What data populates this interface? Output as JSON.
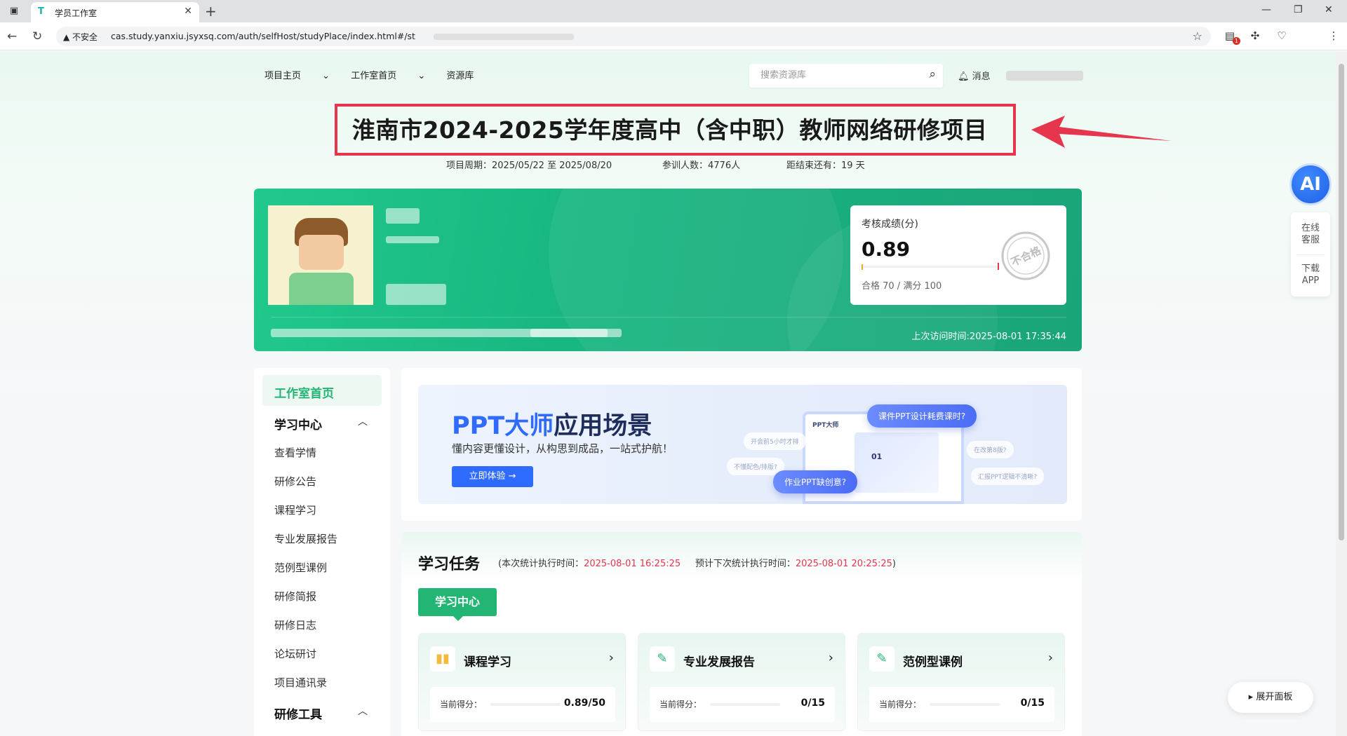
{
  "browser": {
    "tab_title": "学员工作室",
    "insecure_label": "不安全",
    "url": "cas.study.yanxiu.jsyxsq.com/auth/selfHost/studyPlace/index.html#/st",
    "ext_badge": "1"
  },
  "topnav": {
    "items": [
      "项目主页",
      "工作室首页",
      "资源库"
    ],
    "search_placeholder": "搜索资源库",
    "messages": "消息"
  },
  "project": {
    "title": "淮南市2024-2025学年度高中（含中职）教师网络研修项目",
    "period_label": "项目周期：",
    "period": "2025/05/22 至 2025/08/20",
    "participants_label": "参训人数：",
    "participants": "4776人",
    "remaining_label": "距结束还有：",
    "remaining": "19 天"
  },
  "score": {
    "label": "考核成绩(分)",
    "value": "0.89",
    "progress_fraction": 0.0127,
    "pass_label": "合格 70 / 满分 100",
    "stamp_text": "不合格",
    "last_visit": "上次访问时间:2025-08-01 17:35:44"
  },
  "sidebar": {
    "home": "工作室首页",
    "section1": "学习中心",
    "items": [
      "查看学情",
      "研修公告",
      "课程学习",
      "专业发展报告",
      "范例型课例",
      "研修简报",
      "研修日志",
      "论坛研讨",
      "项目通讯录"
    ],
    "section2": "研修工具"
  },
  "ad": {
    "title_a": "PPT大师",
    "title_b": "应用场景",
    "subtitle": "懂内容更懂设计，从构思到成品，一站式护航！",
    "button": "立即体验",
    "mock_title": "PPT大师",
    "mock_slide": "01",
    "pill1": "课件PPT设计耗费课时?",
    "pill2": "作业PPT缺创意?",
    "ghost1": "开会前5小时才排",
    "ghost2": "不懂配色/排版?",
    "ghost3": "在改第8版?",
    "ghost4": "汇报PPT逻辑不清晰?"
  },
  "tasks": {
    "title": "学习任务",
    "note_open": "(本次统计执行时间：",
    "run_time": "2025-08-01 16:25:25",
    "note_mid": "预计下次统计执行时间：",
    "next_time": "2025-08-01 20:25:25",
    "note_close": ")",
    "tab": "学习中心",
    "cards": [
      {
        "name": "课程学习",
        "score_label": "当前得分：",
        "score": "0.89/50"
      },
      {
        "name": "专业发展报告",
        "score_label": "当前得分：",
        "score": "0/15"
      },
      {
        "name": "范例型课例",
        "score_label": "当前得分：",
        "score": "0/15"
      }
    ]
  },
  "floaters": {
    "ai": "AI",
    "service_1": "在线",
    "service_2": "客服",
    "app_1": "下载",
    "app_2": "APP",
    "expand": "展开面板"
  }
}
